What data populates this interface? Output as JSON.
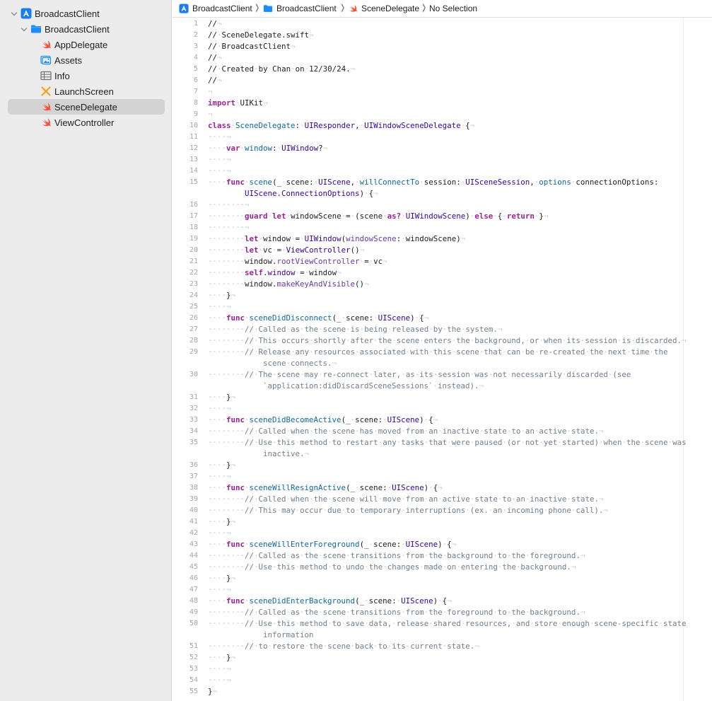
{
  "navigator": {
    "project": "BroadcastClient",
    "group": "BroadcastClient",
    "files": [
      {
        "label": "AppDelegate",
        "icon": "swift-icon"
      },
      {
        "label": "Assets",
        "icon": "asset-catalog-icon"
      },
      {
        "label": "Info",
        "icon": "plist-icon"
      },
      {
        "label": "LaunchScreen",
        "icon": "storyboard-icon"
      },
      {
        "label": "SceneDelegate",
        "icon": "swift-icon",
        "selected": true
      },
      {
        "label": "ViewController",
        "icon": "swift-icon"
      }
    ]
  },
  "jumpbar": {
    "project": "BroadcastClient",
    "folder": "BroadcastClient",
    "file": "SceneDelegate",
    "symbol": "No Selection",
    "separator": "❭"
  },
  "code": {
    "lines": [
      {
        "n": "1",
        "html": "//<i>¬</i>"
      },
      {
        "n": "2",
        "html": "//<i>·</i>SceneDelegate.swift<i>¬</i>"
      },
      {
        "n": "3",
        "html": "//<i>·</i>BroadcastClient<i>¬</i>"
      },
      {
        "n": "4",
        "html": "//<i>¬</i>"
      },
      {
        "n": "5",
        "html": "//<i>·</i>Created<i>·</i>by<i>·</i>Chan<i>·</i>on<i>·</i>12/30/24.<i>¬</i>"
      },
      {
        "n": "6",
        "html": "//<i>¬</i>"
      },
      {
        "n": "7",
        "html": "<i>¬</i>"
      },
      {
        "n": "8",
        "html": "<k>import</k><i>·</i>UIKit<i>¬</i>"
      },
      {
        "n": "9",
        "html": "<i>¬</i>"
      },
      {
        "n": "10",
        "html": "<k>class</k><i>·</i><f>SceneDelegate</f>:<i>·</i><t>UIResponder</t>,<i>·</i><t>UIWindowSceneDelegate</t><i>·</i>{<i>¬</i>"
      },
      {
        "n": "11",
        "html": "<i>····¬</i>"
      },
      {
        "n": "12",
        "html": "<i>····</i><k>var</k><i>·</i><f>window</f>:<i>·</i><t>UIWindow</t>?<i>¬</i>"
      },
      {
        "n": "13",
        "html": "<i>····¬</i>"
      },
      {
        "n": "14",
        "html": "<i>····¬</i>"
      },
      {
        "n": "15",
        "html": "<i>····</i><k>func</k><i>·</i><f>scene</f>(_<i>·</i>scene:<i>·</i><t>UIScene</t>,<i>·</i><f>willConnectTo</f><i>·</i>session:<i>·</i><t>UISceneSession</t>,<i>·</i><f>options</f><i>·</i>connectionOptions:"
      },
      {
        "n": "",
        "html": "        <t>UIScene</t>.<t>ConnectionOptions</t>)<i>·</i>{<i>¬</i>"
      },
      {
        "n": "16",
        "html": "<i>········¬</i>"
      },
      {
        "n": "17",
        "html": "<i>········</i><k>guard</k><i>·</i><k>let</k><i>·</i>windowScene<i>·</i>=<i>·</i>(scene<i>·</i><k>as?</k><i>·</i><t>UIWindowScene</t>)<i>·</i><k>else</k><i>·</i>{<i>·</i><k>return</k><i>·</i>}<i>¬</i>"
      },
      {
        "n": "18",
        "html": "<i>········¬</i>"
      },
      {
        "n": "19",
        "html": "<i>········</i><k>let</k><i>·</i>window<i>·</i>=<i>·</i><t>UIWindow</t>(<m>windowScene</m>:<i>·</i>windowScene)<i>¬</i>"
      },
      {
        "n": "20",
        "html": "<i>········</i><k>let</k><i>·</i>vc<i>·</i>=<i>·</i><t>ViewController</t>()<i>¬</i>"
      },
      {
        "n": "21",
        "html": "<i>········</i>window.<m>rootViewController</m><i>·</i>=<i>·</i>vc<i>¬</i>"
      },
      {
        "n": "22",
        "html": "<i>········</i><k>self</k>.<t>window</t><i>·</i>=<i>·</i>window<i>¬</i>"
      },
      {
        "n": "23",
        "html": "<i>········</i>window.<m>makeKeyAndVisible</m>()<i>¬</i>"
      },
      {
        "n": "24",
        "html": "<i>····</i>}<i>¬</i>"
      },
      {
        "n": "25",
        "html": "<i>····¬</i>"
      },
      {
        "n": "26",
        "html": "<i>····</i><k>func</k><i>·</i><f>sceneDidDisconnect</f>(_<i>·</i>scene:<i>·</i><t>UIScene</t>)<i>·</i>{<i>¬</i>"
      },
      {
        "n": "27",
        "html": "<i>········</i><c>//<i>·</i>Called<i>·</i>as<i>·</i>the<i>·</i>scene<i>·</i>is<i>·</i>being<i>·</i>released<i>·</i>by<i>·</i>the<i>·</i>system.</c><i>¬</i>"
      },
      {
        "n": "28",
        "html": "<i>········</i><c>//<i>·</i>This<i>·</i>occurs<i>·</i>shortly<i>·</i>after<i>·</i>the<i>·</i>scene<i>·</i>enters<i>·</i>the<i>·</i>background,<i>·</i>or<i>·</i>when<i>·</i>its<i>·</i>session<i>·</i>is<i>·</i>discarded.</c><i>¬</i>"
      },
      {
        "n": "29",
        "html": "<i>········</i><c>//<i>·</i>Release<i>·</i>any<i>·</i>resources<i>·</i>associated<i>·</i>with<i>·</i>this<i>·</i>scene<i>·</i>that<i>·</i>can<i>·</i>be<i>·</i>re-created<i>·</i>the<i>·</i>next<i>·</i>time<i>·</i>the</c>"
      },
      {
        "n": "",
        "html": "            <c>scene<i>·</i>connects.</c><i>¬</i>"
      },
      {
        "n": "30",
        "html": "<i>········</i><c>//<i>·</i>The<i>·</i>scene<i>·</i>may<i>·</i>re-connect<i>·</i>later,<i>·</i>as<i>·</i>its<i>·</i>session<i>·</i>was<i>·</i>not<i>·</i>necessarily<i>·</i>discarded<i>·</i>(see</c>"
      },
      {
        "n": "",
        "html": "            <c>`application:didDiscardSceneSessions`<i>·</i>instead).</c><i>¬</i>"
      },
      {
        "n": "31",
        "html": "<i>····</i>}<i>¬</i>"
      },
      {
        "n": "32",
        "html": "<i>····¬</i>"
      },
      {
        "n": "33",
        "html": "<i>····</i><k>func</k><i>·</i><f>sceneDidBecomeActive</f>(_<i>·</i>scene:<i>·</i><t>UIScene</t>)<i>·</i>{<i>¬</i>"
      },
      {
        "n": "34",
        "html": "<i>········</i><c>//<i>·</i>Called<i>·</i>when<i>·</i>the<i>·</i>scene<i>·</i>has<i>·</i>moved<i>·</i>from<i>·</i>an<i>·</i>inactive<i>·</i>state<i>·</i>to<i>·</i>an<i>·</i>active<i>·</i>state.</c><i>¬</i>"
      },
      {
        "n": "35",
        "html": "<i>········</i><c>//<i>·</i>Use<i>·</i>this<i>·</i>method<i>·</i>to<i>·</i>restart<i>·</i>any<i>·</i>tasks<i>·</i>that<i>·</i>were<i>·</i>paused<i>·</i>(or<i>·</i>not<i>·</i>yet<i>·</i>started)<i>·</i>when<i>·</i>the<i>·</i>scene<i>·</i>was</c>"
      },
      {
        "n": "",
        "html": "            <c>inactive.</c><i>¬</i>"
      },
      {
        "n": "36",
        "html": "<i>····</i>}<i>¬</i>"
      },
      {
        "n": "37",
        "html": "<i>····¬</i>"
      },
      {
        "n": "38",
        "html": "<i>····</i><k>func</k><i>·</i><f>sceneWillResignActive</f>(_<i>·</i>scene:<i>·</i><t>UIScene</t>)<i>·</i>{<i>¬</i>"
      },
      {
        "n": "39",
        "html": "<i>········</i><c>//<i>·</i>Called<i>·</i>when<i>·</i>the<i>·</i>scene<i>·</i>will<i>·</i>move<i>·</i>from<i>·</i>an<i>·</i>active<i>·</i>state<i>·</i>to<i>·</i>an<i>·</i>inactive<i>·</i>state.</c><i>¬</i>"
      },
      {
        "n": "40",
        "html": "<i>········</i><c>//<i>·</i>This<i>·</i>may<i>·</i>occur<i>·</i>due<i>·</i>to<i>·</i>temporary<i>·</i>interruptions<i>·</i>(ex.<i>·</i>an<i>·</i>incoming<i>·</i>phone<i>·</i>call).</c><i>¬</i>"
      },
      {
        "n": "41",
        "html": "<i>····</i>}<i>¬</i>"
      },
      {
        "n": "42",
        "html": "<i>····¬</i>"
      },
      {
        "n": "43",
        "html": "<i>····</i><k>func</k><i>·</i><f>sceneWillEnterForeground</f>(_<i>·</i>scene:<i>·</i><t>UIScene</t>)<i>·</i>{<i>¬</i>"
      },
      {
        "n": "44",
        "html": "<i>········</i><c>//<i>·</i>Called<i>·</i>as<i>·</i>the<i>·</i>scene<i>·</i>transitions<i>·</i>from<i>·</i>the<i>·</i>background<i>·</i>to<i>·</i>the<i>·</i>foreground.</c><i>¬</i>"
      },
      {
        "n": "45",
        "html": "<i>········</i><c>//<i>·</i>Use<i>·</i>this<i>·</i>method<i>·</i>to<i>·</i>undo<i>·</i>the<i>·</i>changes<i>·</i>made<i>·</i>on<i>·</i>entering<i>·</i>the<i>·</i>background.</c><i>¬</i>"
      },
      {
        "n": "46",
        "html": "<i>····</i>}<i>¬</i>"
      },
      {
        "n": "47",
        "html": "<i>····¬</i>"
      },
      {
        "n": "48",
        "html": "<i>····</i><k>func</k><i>·</i><f>sceneDidEnterBackground</f>(_<i>·</i>scene:<i>·</i><t>UIScene</t>)<i>·</i>{<i>¬</i>"
      },
      {
        "n": "49",
        "html": "<i>········</i><c>//<i>·</i>Called<i>·</i>as<i>·</i>the<i>·</i>scene<i>·</i>transitions<i>·</i>from<i>·</i>the<i>·</i>foreground<i>·</i>to<i>·</i>the<i>·</i>background.</c><i>¬</i>"
      },
      {
        "n": "50",
        "html": "<i>········</i><c>//<i>·</i>Use<i>·</i>this<i>·</i>method<i>·</i>to<i>·</i>save<i>·</i>data,<i>·</i>release<i>·</i>shared<i>·</i>resources,<i>·</i>and<i>·</i>store<i>·</i>enough<i>·</i>scene-specific<i>·</i>state</c>"
      },
      {
        "n": "",
        "html": "            <c>information</c>"
      },
      {
        "n": "51",
        "html": "<i>········</i><c>//<i>·</i>to<i>·</i>restore<i>·</i>the<i>·</i>scene<i>·</i>back<i>·</i>to<i>·</i>its<i>·</i>current<i>·</i>state.</c><i>¬</i>"
      },
      {
        "n": "52",
        "html": "<i>····</i>}<i>¬</i>"
      },
      {
        "n": "53",
        "html": "<i>····¬</i>"
      },
      {
        "n": "54",
        "html": "<i>····¬</i>"
      },
      {
        "n": "55",
        "html": "}<i>¬</i>"
      }
    ]
  },
  "colors": {
    "keyword": "#9b2393",
    "type": "#3900a0",
    "declaration": "#0f68a0",
    "method": "#6c36a9",
    "comment": "#707f8c",
    "selection": "#d3d3d3",
    "sidebar_bg": "#ececec"
  }
}
